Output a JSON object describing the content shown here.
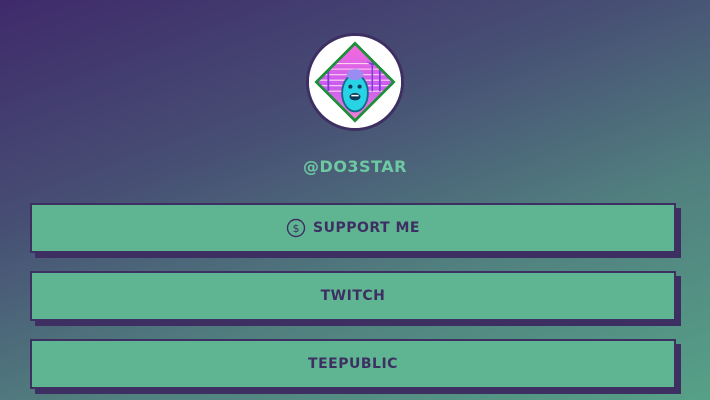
{
  "profile": {
    "handle": "@DO3STAR",
    "avatar_icon": "synthwave-creature-avatar"
  },
  "links": [
    {
      "label": "SUPPORT ME",
      "icon": "dollar-coin-icon"
    },
    {
      "label": "TWITCH"
    },
    {
      "label": "TEEPUBLIC"
    }
  ],
  "colors": {
    "button_background": "#5fb592",
    "button_border": "#3e2f62",
    "text_dark": "#3e2f62",
    "handle_text": "#6cc9a1"
  }
}
